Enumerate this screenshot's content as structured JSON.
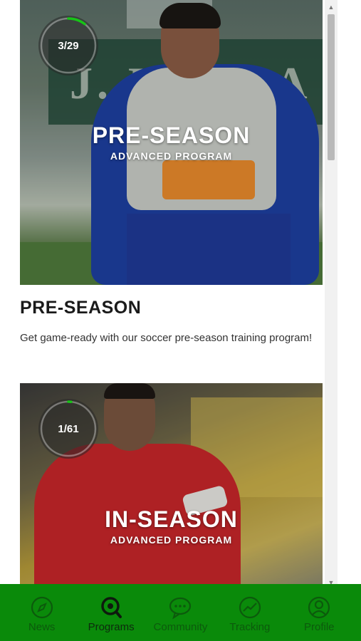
{
  "programs": [
    {
      "progress_text": "3/29",
      "progress_fraction": 0.1034,
      "overlay_title": "PRE-SEASON",
      "overlay_subtitle": "ADVANCED PROGRAM",
      "heading": "PRE-SEASON",
      "description": "Get game-ready with our soccer pre-season training program!",
      "banner_text": "J. ENGLA"
    },
    {
      "progress_text": "1/61",
      "progress_fraction": 0.0164,
      "overlay_title": "IN-SEASON",
      "overlay_subtitle": "ADVANCED PROGRAM"
    }
  ],
  "nav": {
    "items": [
      {
        "label": "News",
        "icon": "compass-icon",
        "active": false
      },
      {
        "label": "Programs",
        "icon": "search-icon",
        "active": true
      },
      {
        "label": "Community",
        "icon": "chat-bubble-icon",
        "active": false
      },
      {
        "label": "Tracking",
        "icon": "chart-icon",
        "active": false
      },
      {
        "label": "Profile",
        "icon": "person-icon",
        "active": false
      }
    ]
  },
  "colors": {
    "nav_bg": "#0a8a0a",
    "ring_accent": "#17c417",
    "ring_track": "rgba(255,255,255,0.35)"
  }
}
